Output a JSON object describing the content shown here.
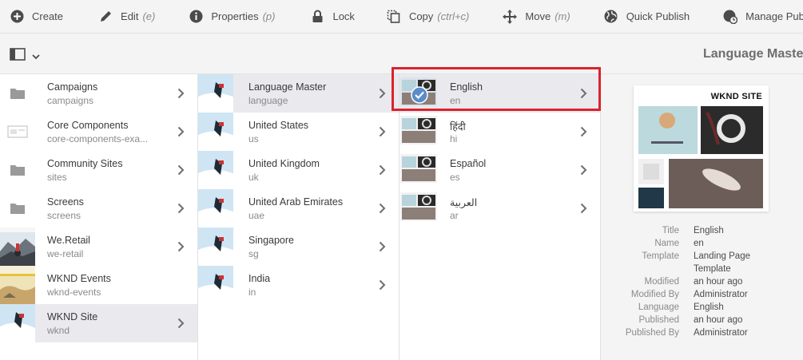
{
  "toolbar": {
    "create": "Create",
    "edit": "Edit",
    "edit_shortcut": "(e)",
    "properties": "Properties",
    "properties_shortcut": "(p)",
    "lock": "Lock",
    "copy": "Copy",
    "copy_shortcut": "(ctrl+c)",
    "move": "Move",
    "move_shortcut": "(m)",
    "quick_publish": "Quick Publish",
    "manage_publication": "Manage Publication"
  },
  "header": {
    "title": "Language Master"
  },
  "column1": [
    {
      "title": "Campaigns",
      "name": "campaigns",
      "icon": "folder-icon"
    },
    {
      "title": "Core Components",
      "name": "core-components-exa...",
      "icon": "component-icon"
    },
    {
      "title": "Community Sites",
      "name": "sites",
      "icon": "folder-icon"
    },
    {
      "title": "Screens",
      "name": "screens",
      "icon": "folder-icon"
    },
    {
      "title": "We.Retail",
      "name": "we-retail",
      "icon": "thumbnail"
    },
    {
      "title": "WKND Events",
      "name": "wknd-events",
      "icon": "thumbnail"
    },
    {
      "title": "WKND Site",
      "name": "wknd",
      "icon": "thumbnail",
      "active": true
    }
  ],
  "column2": [
    {
      "title": "Language Master",
      "name": "language",
      "active": true
    },
    {
      "title": "United States",
      "name": "us"
    },
    {
      "title": "United Kingdom",
      "name": "uk"
    },
    {
      "title": "United Arab Emirates",
      "name": "uae"
    },
    {
      "title": "Singapore",
      "name": "sg"
    },
    {
      "title": "India",
      "name": "in"
    }
  ],
  "column3": [
    {
      "title": "English",
      "name": "en",
      "active": true,
      "selected": true
    },
    {
      "title": "हिंदी",
      "name": "hi"
    },
    {
      "title": "Español",
      "name": "es"
    },
    {
      "title": "العربية",
      "name": "ar"
    }
  ],
  "preview": {
    "logo": "WKND SITE"
  },
  "properties": {
    "rows": [
      {
        "key": "Title",
        "value": "English"
      },
      {
        "key": "Name",
        "value": "en"
      },
      {
        "key": "Template",
        "value": "Landing Page"
      },
      {
        "key": "",
        "value": "Template"
      },
      {
        "key": "Modified",
        "value": "an hour ago"
      },
      {
        "key": "Modified By",
        "value": "Administrator"
      },
      {
        "key": "Language",
        "value": "English"
      },
      {
        "key": "Published",
        "value": "an hour ago"
      },
      {
        "key": "Published By",
        "value": "Administrator"
      }
    ]
  },
  "colors": {
    "highlight": "#d9232e",
    "active_row": "#e9e9ee",
    "check_badge": "#5a8dc9"
  }
}
